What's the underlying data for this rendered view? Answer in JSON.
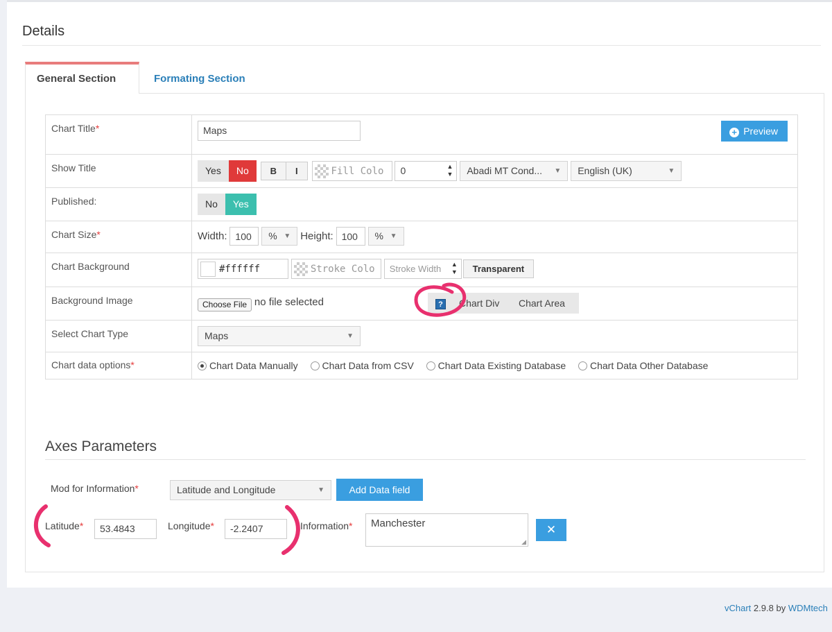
{
  "details": {
    "title": "Details"
  },
  "tabs": [
    {
      "label": "General Section",
      "active": true
    },
    {
      "label": "Formating Section",
      "active": false
    }
  ],
  "form": {
    "chart_title": {
      "label": "Chart Title",
      "value": "Maps"
    },
    "preview_label": "Preview",
    "show_title": {
      "label": "Show Title",
      "yes": "Yes",
      "no": "No",
      "bold": "B",
      "italic": "I",
      "fill_color_placeholder": "Fill Colo",
      "font_size": "0",
      "font_family": "Abadi MT Cond...",
      "language": "English (UK)"
    },
    "published": {
      "label": "Published:",
      "no": "No",
      "yes": "Yes"
    },
    "chart_size": {
      "label": "Chart Size",
      "width_label": "Width:",
      "width_value": "100",
      "width_unit": "%",
      "height_label": "Height:",
      "height_value": "100",
      "height_unit": "%"
    },
    "chart_background": {
      "label": "Chart Background",
      "color_value": "#ffffff",
      "stroke_color_placeholder": "Stroke Colo",
      "stroke_width_placeholder": "Stroke Width",
      "transparent_label": "Transparent"
    },
    "background_image": {
      "label": "Background Image",
      "choose_file": "Choose File",
      "no_file": "no file selected",
      "help": "?",
      "chart_div": "Chart Div",
      "chart_area": "Chart Area"
    },
    "chart_type": {
      "label": "Select Chart Type",
      "value": "Maps"
    },
    "data_options": {
      "label": "Chart data options",
      "options": [
        {
          "label": "Chart Data Manually",
          "checked": true
        },
        {
          "label": "Chart Data from CSV",
          "checked": false
        },
        {
          "label": "Chart Data Existing Database",
          "checked": false
        },
        {
          "label": "Chart Data Other Database",
          "checked": false
        }
      ]
    }
  },
  "axes": {
    "title": "Axes Parameters",
    "mod_label": "Mod for Information",
    "mod_value": "Latitude and Longitude",
    "add_field": "Add Data field",
    "latitude_label": "Latitude",
    "latitude_value": "53.4843",
    "longitude_label": "Longitude",
    "longitude_value": "-2.2407",
    "information_label": "Information",
    "information_value": "Manchester",
    "remove_symbol": "✕"
  },
  "footer": {
    "app": "vChart",
    "version": "2.9.8",
    "by": "by",
    "vendor": "WDMtech"
  },
  "colors": {
    "accent_blue": "#3a9ee0",
    "danger_red": "#e03a3a",
    "success_teal": "#3cbfae",
    "annotation_pink": "#e8306e"
  }
}
